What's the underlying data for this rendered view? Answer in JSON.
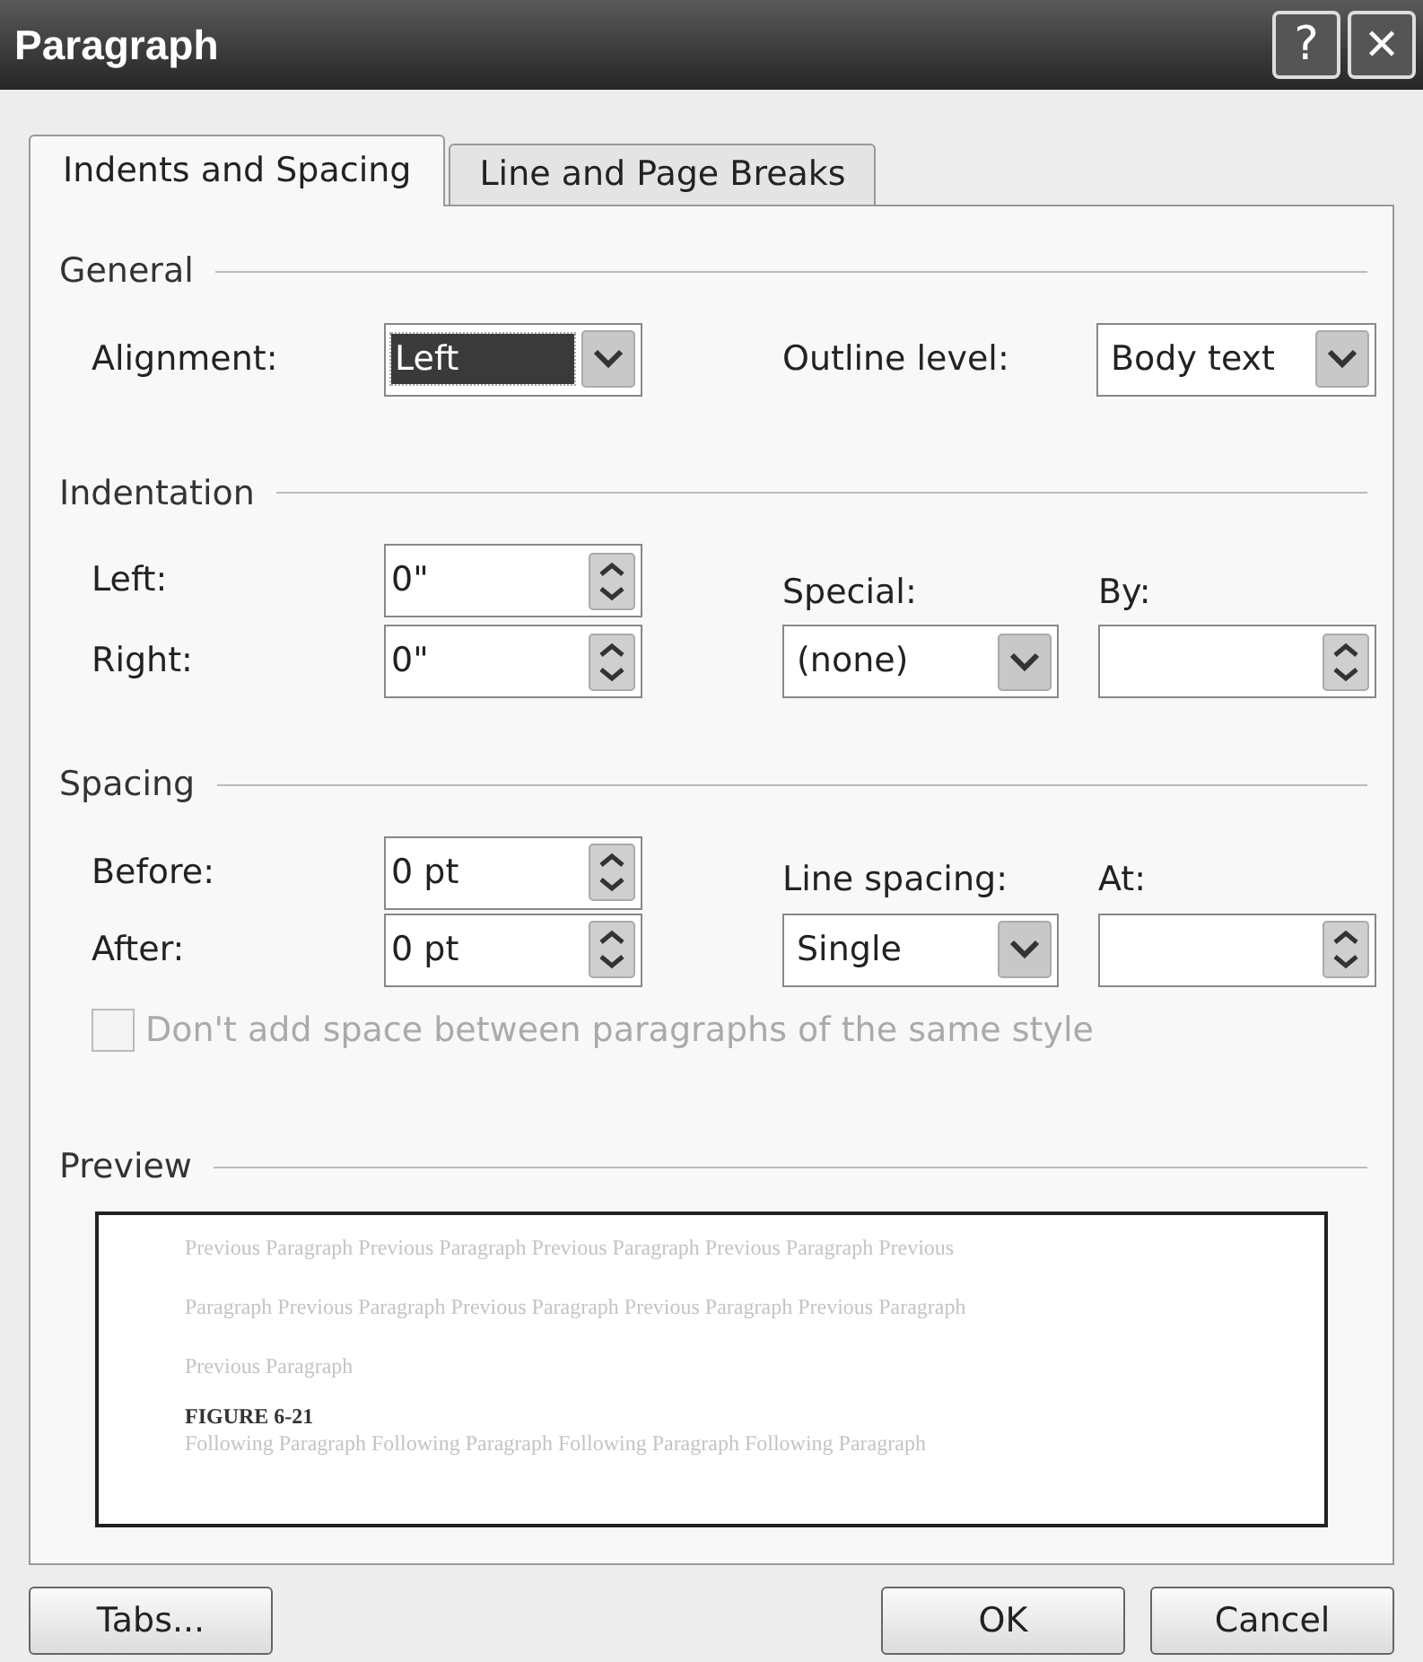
{
  "window": {
    "title": "Paragraph",
    "help_button": "?",
    "close_button": "✕"
  },
  "tabs": [
    {
      "label": "Indents and Spacing",
      "selected": true
    },
    {
      "label": "Line and Page Breaks",
      "selected": false
    }
  ],
  "general": {
    "title": "General",
    "alignment": {
      "label": "Alignment:",
      "kind": "dropdown",
      "value": "Left",
      "focused": true
    },
    "outline_level": {
      "label": "Outline level:",
      "kind": "dropdown",
      "value": "Body text",
      "focused": false
    }
  },
  "indentation": {
    "title": "Indentation",
    "left": {
      "label": "Left:",
      "kind": "spin",
      "value": "0\""
    },
    "right": {
      "label": "Right:",
      "kind": "spin",
      "value": "0\""
    },
    "special": {
      "label": "Special:",
      "kind": "dropdown",
      "value": "(none)",
      "focused": false
    },
    "by": {
      "label": "By:",
      "kind": "spin"
    }
  },
  "spacing": {
    "title": "Spacing",
    "before": {
      "label": "Before:",
      "kind": "spin",
      "value": "0 pt"
    },
    "after": {
      "label": "After:",
      "kind": "spin",
      "value": "0 pt"
    },
    "line_spacing": {
      "label": "Line spacing:",
      "kind": "dropdown",
      "value": "Single",
      "focused": false
    },
    "at": {
      "label": "At:",
      "kind": "spin"
    },
    "checkbox": {
      "label": "Don't add space between paragraphs of the same style",
      "checked": false,
      "disabled": true
    }
  },
  "preview": {
    "title": "Preview",
    "previous_lines": [
      "Previous Paragraph Previous Paragraph Previous Paragraph Previous Paragraph Previous",
      "Paragraph Previous Paragraph Previous Paragraph Previous Paragraph Previous Paragraph",
      "Previous Paragraph"
    ],
    "caption": "FIGURE 6-21",
    "following_lines": [
      "Following Paragraph Following Paragraph Following Paragraph Following Paragraph"
    ]
  },
  "buttons": [
    {
      "label": "Tabs..."
    },
    {
      "label": "OK"
    },
    {
      "label": "Cancel"
    }
  ]
}
